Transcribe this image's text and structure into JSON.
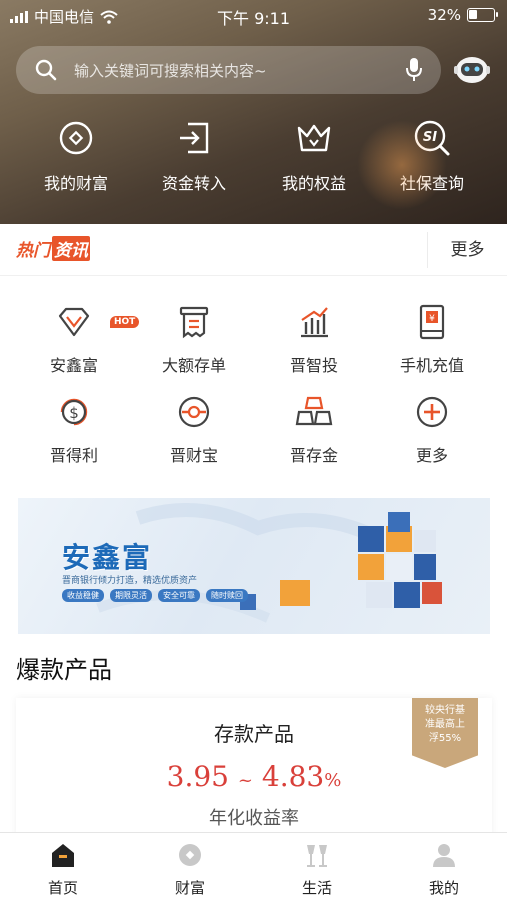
{
  "status": {
    "carrier": "中国电信",
    "time": "下午 9:11",
    "battery": "32%"
  },
  "search": {
    "placeholder": "输入关键词可搜索相关内容~"
  },
  "quick_actions": [
    {
      "label": "我的财富",
      "icon": "wealth-icon"
    },
    {
      "label": "资金转入",
      "icon": "transfer-in-icon"
    },
    {
      "label": "我的权益",
      "icon": "crown-icon"
    },
    {
      "label": "社保查询",
      "icon": "social-security-icon"
    }
  ],
  "news": {
    "logo_a": "热门",
    "logo_b": "资讯",
    "more": "更多"
  },
  "grid": [
    {
      "label": "安鑫富",
      "icon": "diamond-icon",
      "badge": "HOT"
    },
    {
      "label": "大额存单",
      "icon": "receipt-icon"
    },
    {
      "label": "晋智投",
      "icon": "bar-chart-icon"
    },
    {
      "label": "手机充值",
      "icon": "phone-recharge-icon"
    },
    {
      "label": "晋得利",
      "icon": "dollar-icon"
    },
    {
      "label": "晋财宝",
      "icon": "coin-icon"
    },
    {
      "label": "晋存金",
      "icon": "gold-bars-icon"
    },
    {
      "label": "更多",
      "icon": "more-icon"
    }
  ],
  "banner": {
    "title": "安鑫富",
    "subtitle": "晋商银行倾力打造，精选优质资产",
    "tags": [
      "收益稳健",
      "期限灵活",
      "安全可靠",
      "随时赎回"
    ]
  },
  "section_title": "爆款产品",
  "product": {
    "title": "存款产品",
    "rate_low": "3.95",
    "rate_sep": "~",
    "rate_high": "4.83",
    "rate_unit": "%",
    "rate_label": "年化收益率",
    "ribbon": [
      "较央行基",
      "准最高上",
      "浮55%"
    ]
  },
  "tabs": [
    {
      "label": "首页",
      "icon": "home-icon"
    },
    {
      "label": "财富",
      "icon": "wealth-tab-icon"
    },
    {
      "label": "生活",
      "icon": "life-icon"
    },
    {
      "label": "我的",
      "icon": "profile-icon"
    }
  ],
  "colors": {
    "accent": "#e8552a",
    "rate": "#d9403a",
    "ribbon": "#c9a77b",
    "banner_title": "#1d6ab8"
  }
}
